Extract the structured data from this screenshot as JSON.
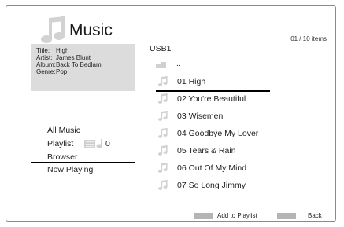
{
  "header": {
    "title": "Music",
    "icon": "music-note-icon"
  },
  "now_info": {
    "rows": [
      {
        "label": "Title:",
        "value": "High"
      },
      {
        "label": "Artist:",
        "value": "James Blunt"
      },
      {
        "label": "Album:",
        "value": "Back To Bedlam"
      },
      {
        "label": "Genre:",
        "value": "Pop"
      }
    ]
  },
  "menu": {
    "all_music": "All Music",
    "playlist": "Playlist",
    "playlist_count": "0",
    "browser": "Browser",
    "now_playing": "Now Playing"
  },
  "browser": {
    "path": "USB1",
    "item_count": "01 / 10 items",
    "up_dir": "..",
    "items": [
      "01 High",
      "02 You're Beautiful",
      "03 Wisemen",
      "04 Goodbye My Lover",
      "05 Tears & Rain",
      "06 Out Of My Mind",
      "07 So Long Jimmy"
    ]
  },
  "footer": {
    "add_to_playlist": "Add to Playlist",
    "back": "Back"
  },
  "colors": {
    "info_box_bg": "#dcdcdc",
    "selection_line": "#000000",
    "icon_gray": "#cfcfcf",
    "button_swatch": "#b5b5b5"
  }
}
